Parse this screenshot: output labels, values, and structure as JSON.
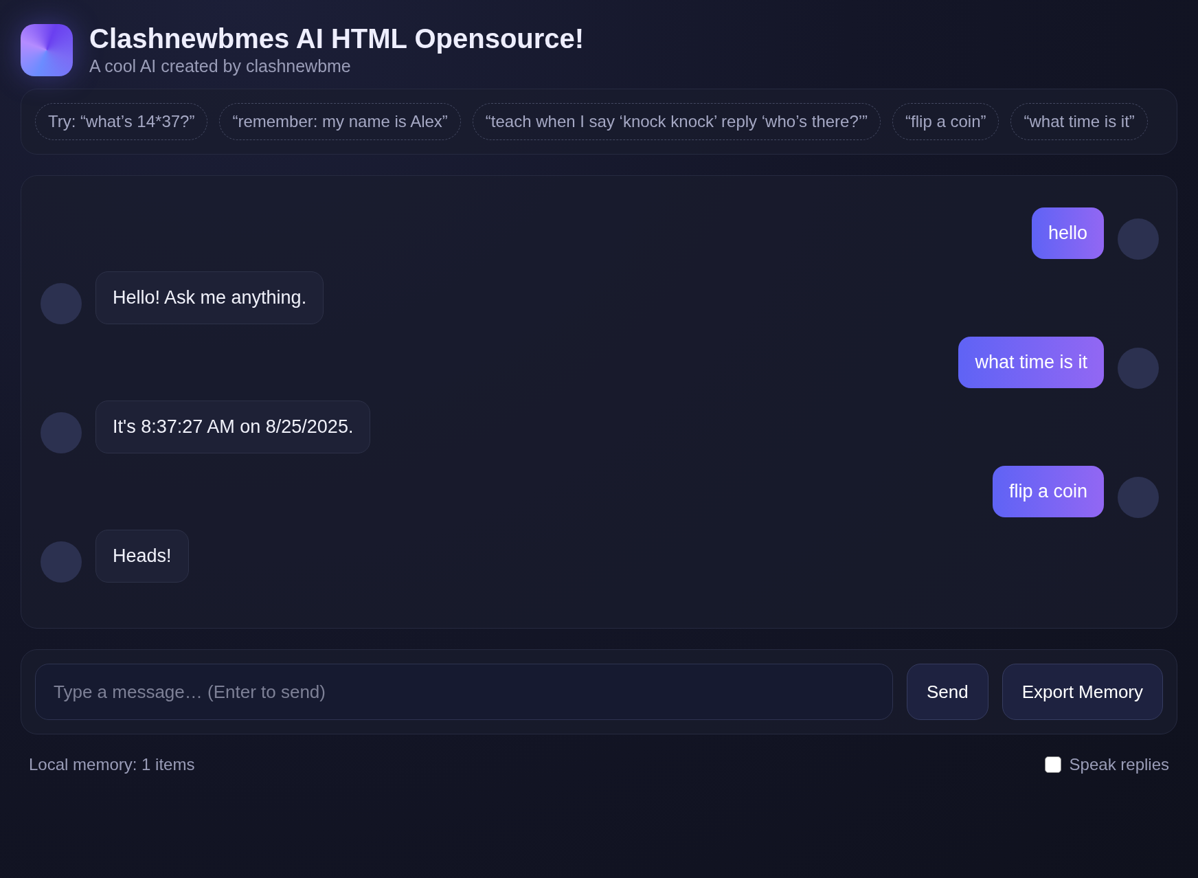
{
  "header": {
    "title": "Clashnewbmes AI HTML Opensource!",
    "subtitle": "A cool AI created by clashnewbme"
  },
  "suggestions": [
    "Try: “what’s 14*37?”",
    "“remember: my name is Alex”",
    "“teach when I say ‘knock knock’ reply ‘who’s there?’”",
    "“flip a coin”",
    "“what time is it”"
  ],
  "messages": [
    {
      "kind": "user",
      "text": "hello"
    },
    {
      "kind": "bot",
      "text": "Hello! Ask me anything."
    },
    {
      "kind": "user",
      "text": "what time is it"
    },
    {
      "kind": "bot",
      "text": "It's 8:37:27 AM on 8/25/2025."
    },
    {
      "kind": "user",
      "text": "flip a coin"
    },
    {
      "kind": "bot",
      "text": "Heads!"
    }
  ],
  "composer": {
    "placeholder": "Type a message… (Enter to send)",
    "send": "Send",
    "export": "Export Memory"
  },
  "footer": {
    "memory": "Local memory: 1 items",
    "speak": {
      "label": "Speak replies",
      "checked": false
    }
  }
}
